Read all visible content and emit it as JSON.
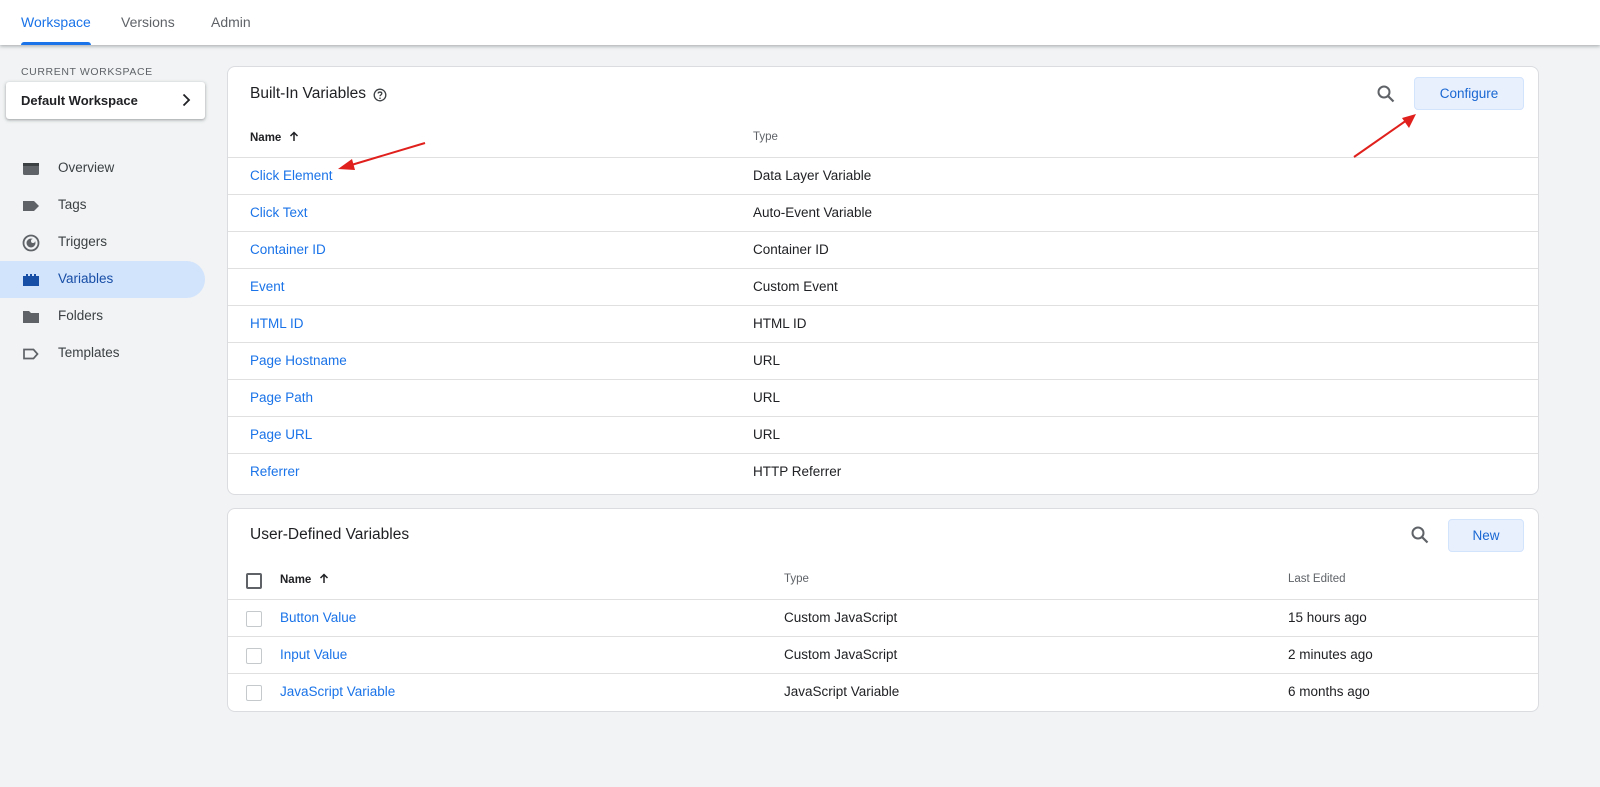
{
  "nav_tabs": [
    {
      "label": "Workspace",
      "active": true
    },
    {
      "label": "Versions"
    },
    {
      "label": "Admin"
    }
  ],
  "sidebar": {
    "workspace_label": "CURRENT WORKSPACE",
    "workspace_name": "Default Workspace",
    "items": [
      {
        "label": "Overview",
        "icon": "overview-icon"
      },
      {
        "label": "Tags",
        "icon": "tag-icon"
      },
      {
        "label": "Triggers",
        "icon": "trigger-icon"
      },
      {
        "label": "Variables",
        "icon": "variables-icon",
        "active": true
      },
      {
        "label": "Folders",
        "icon": "folder-icon"
      },
      {
        "label": "Templates",
        "icon": "template-icon"
      }
    ]
  },
  "builtin": {
    "title": "Built-In Variables",
    "configure_label": "Configure",
    "col_name": "Name",
    "col_type": "Type",
    "rows": [
      {
        "name": "Click Element",
        "type": "Data Layer Variable"
      },
      {
        "name": "Click Text",
        "type": "Auto-Event Variable"
      },
      {
        "name": "Container ID",
        "type": "Container ID"
      },
      {
        "name": "Event",
        "type": "Custom Event"
      },
      {
        "name": "HTML ID",
        "type": "HTML ID"
      },
      {
        "name": "Page Hostname",
        "type": "URL"
      },
      {
        "name": "Page Path",
        "type": "URL"
      },
      {
        "name": "Page URL",
        "type": "URL"
      },
      {
        "name": "Referrer",
        "type": "HTTP Referrer"
      }
    ]
  },
  "userdefined": {
    "title": "User-Defined Variables",
    "new_label": "New",
    "col_name": "Name",
    "col_type": "Type",
    "col_edited": "Last Edited",
    "rows": [
      {
        "name": "Button Value",
        "type": "Custom JavaScript",
        "edited": "15 hours ago"
      },
      {
        "name": "Input Value",
        "type": "Custom JavaScript",
        "edited": "2 minutes ago"
      },
      {
        "name": "JavaScript Variable",
        "type": "JavaScript Variable",
        "edited": "6 months ago"
      }
    ]
  },
  "colors": {
    "accent": "#1a73e8",
    "annotation_arrow": "#e0201c",
    "active_nav_bg": "#d2e3fc"
  }
}
